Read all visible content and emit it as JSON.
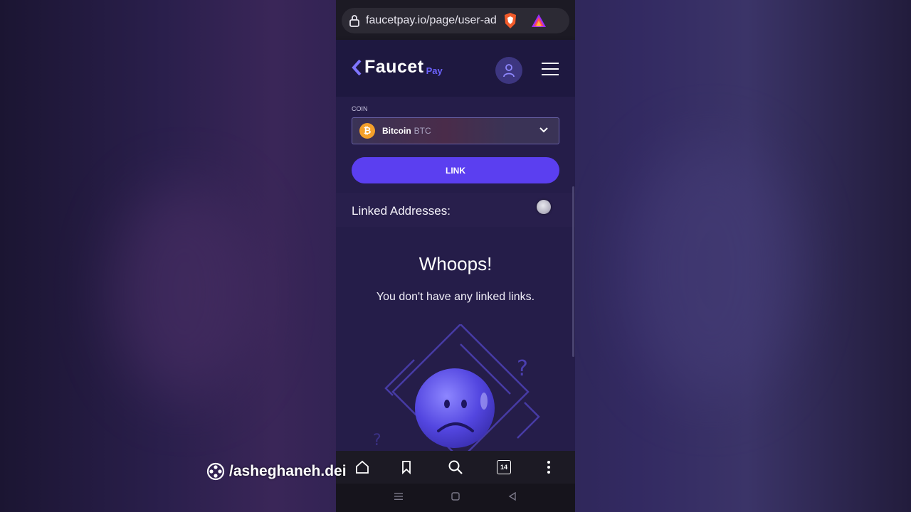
{
  "browser": {
    "url": "faucetpay.io/page/user-ad",
    "tabs_count": "14"
  },
  "header": {
    "logo_main": "Faucet",
    "logo_sub": "Pay"
  },
  "form": {
    "coin_label": "COIN",
    "selected_coin_name": "Bitcoin",
    "selected_coin_ticker": "BTC",
    "coin_symbol": "₿",
    "link_button": "LINK"
  },
  "linked": {
    "title": "Linked Addresses:"
  },
  "empty_state": {
    "title": "Whoops!",
    "message": "You don't have any linked links."
  },
  "watermark": {
    "text": "/asheghaneh.dei"
  },
  "colors": {
    "accent": "#5b3ff0",
    "brand_sub": "#6d63ff",
    "bitcoin": "#f4a02a",
    "page_bg": "#251d49"
  }
}
